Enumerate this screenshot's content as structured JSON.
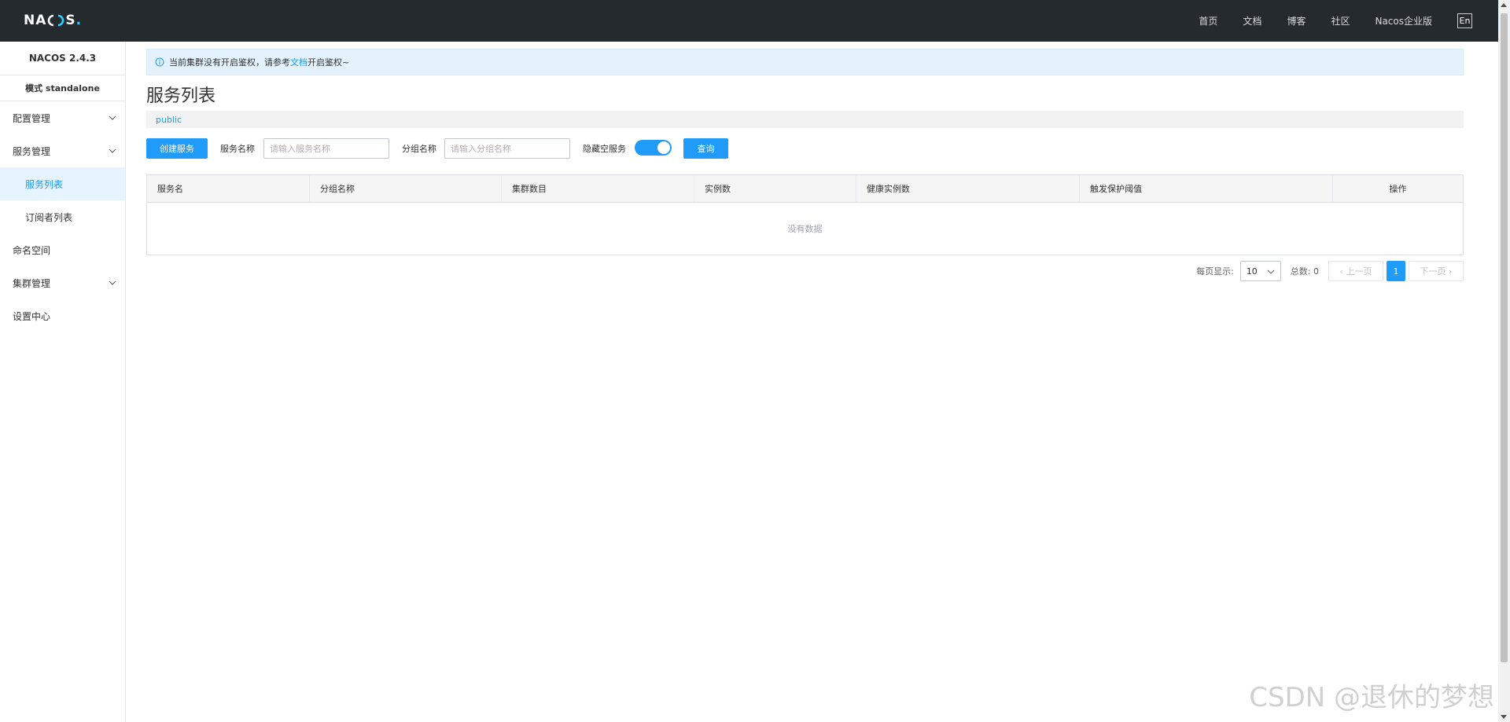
{
  "header": {
    "logo_text": "NACOS.",
    "nav": [
      "首页",
      "文档",
      "博客",
      "社区",
      "Nacos企业版"
    ],
    "lang": "En"
  },
  "sidebar": {
    "version": "NACOS 2.4.3",
    "mode": "模式 standalone",
    "items": [
      {
        "label": "配置管理"
      },
      {
        "label": "服务管理"
      },
      {
        "label": "服务列表"
      },
      {
        "label": "订阅者列表"
      },
      {
        "label": "命名空间"
      },
      {
        "label": "集群管理"
      },
      {
        "label": "设置中心"
      }
    ]
  },
  "notice": {
    "prefix": "当前集群没有开启鉴权，请参考",
    "link": "文档",
    "suffix": "开启鉴权~"
  },
  "page": {
    "title": "服务列表",
    "namespace": "public"
  },
  "filter": {
    "create_label": "创建服务",
    "service_name_label": "服务名称",
    "service_name_placeholder": "请输入服务名称",
    "group_name_label": "分组名称",
    "group_name_placeholder": "请输入分组名称",
    "hide_empty_label": "隐藏空服务",
    "hide_empty_on": true,
    "query_label": "查询"
  },
  "table": {
    "columns": [
      "服务名",
      "分组名称",
      "集群数目",
      "实例数",
      "健康实例数",
      "触发保护阈值",
      "操作"
    ],
    "empty_text": "没有数据"
  },
  "pagination": {
    "per_page_label": "每页显示:",
    "per_page_value": "10",
    "total_label": "总数: 0",
    "prev_label": "上一页",
    "next_label": "下一页",
    "current_page": "1"
  },
  "watermark": "CSDN @退休的梦想",
  "colors": {
    "primary": "#209bfa",
    "header_bg": "#252a2f",
    "active_bg": "#e5f4ff",
    "notice_bg": "#e3f2fd"
  }
}
